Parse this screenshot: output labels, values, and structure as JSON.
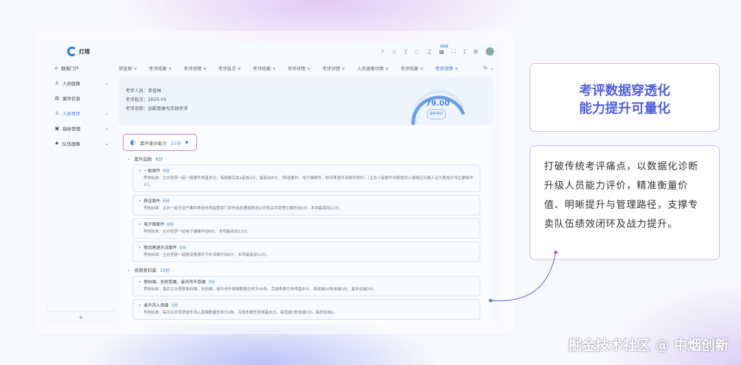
{
  "app": {
    "name": "灯塔"
  },
  "header_icons": [
    "search-icon",
    "star-icon",
    "translate-icon",
    "message-icon",
    "bell-icon",
    "apps-icon",
    "fullscreen-icon",
    "language-icon",
    "settings-icon",
    "avatar"
  ],
  "header_badge": "NEW",
  "sidebar": {
    "items": [
      {
        "label": "数据门户"
      },
      {
        "label": "人员画像"
      },
      {
        "label": "案件信息"
      },
      {
        "label": "人员考评"
      },
      {
        "label": "指标管理"
      },
      {
        "label": "队伍画像"
      }
    ],
    "collapse": "«"
  },
  "tabs": [
    "研发册",
    "考评结果",
    "考评详情",
    "考评批次",
    "考评结果",
    "考评详情",
    "考评详情",
    "人员画像详情",
    "考评结果",
    "考评详情"
  ],
  "info": {
    "person": "考评人员：李佳林",
    "batch": "考评批次：2025-05",
    "name": "考评名称：创新思维与实践考评"
  },
  "gauge": {
    "value": "79.00",
    "label": "最终得分",
    "fraction": 0.79
  },
  "capability": {
    "label": "案件查办能力",
    "score": "21分"
  },
  "sections": [
    {
      "label": "案件起数",
      "score": "6分",
      "items": [
        {
          "title": "一般案件",
          "score": "0分",
          "desc": "考核标准：主办查获一起一般案件得基本分，每超额完成1起加2分，最高加8分。（移送案件、电子烟案件、物流寄递外流案件除外）（主办人指案件线索提供人或辖区归属人且为案卷文书主要制作人）。"
        },
        {
          "title": "移送案件",
          "score": "0分",
          "desc": "考核标准：主办一起无证户案件移送市场监管部门并作出处理或移送公安机关并受理立案的加6分，本项最高加12分。"
        },
        {
          "title": "电子烟案件",
          "score": "6分",
          "desc": "考核标准：主办查获一起电子烟案件加6分，本项最高加12分。"
        },
        {
          "title": "物流寄递外流案件",
          "score": "0分",
          "desc": "考核标准：主办查获一起物流寄递环节外流案件加6分，本项最高加12分。"
        }
      ]
    },
    {
      "label": "卷烟查扣量",
      "score": "15分",
      "items": [
        {
          "title": "串码烟、无码卷烟、省内市外卷烟",
          "score": "3分",
          "desc": "考核标准：每月主办查获串码烟、无码烟、省内市外卷烟数量任务为30条，完成条数任务得基本分，每增减10条加减1分，最多加减2分。"
        },
        {
          "title": "省外流入真烟",
          "score": "3分",
          "desc": "考核标准：每月主办查获省外流入真烟数量任务为3条，完成条数任务得基本分，每增减1条加减1分，最多加减2。"
        }
      ]
    }
  ],
  "callout": {
    "headline1": "考评数据穿透化",
    "headline2": "能力提升可量化",
    "body": "打破传统考评痛点，以数据化诊断升级人员能力评价，精准衡量价值、明晰提升与管理路径，支撑专卖队伍绩效闭环及战力提升。"
  },
  "watermark": "掘金技术社区 @ 中烟创新",
  "colors": {
    "accent": "#2b7be8",
    "border": "#d7b7ee"
  }
}
